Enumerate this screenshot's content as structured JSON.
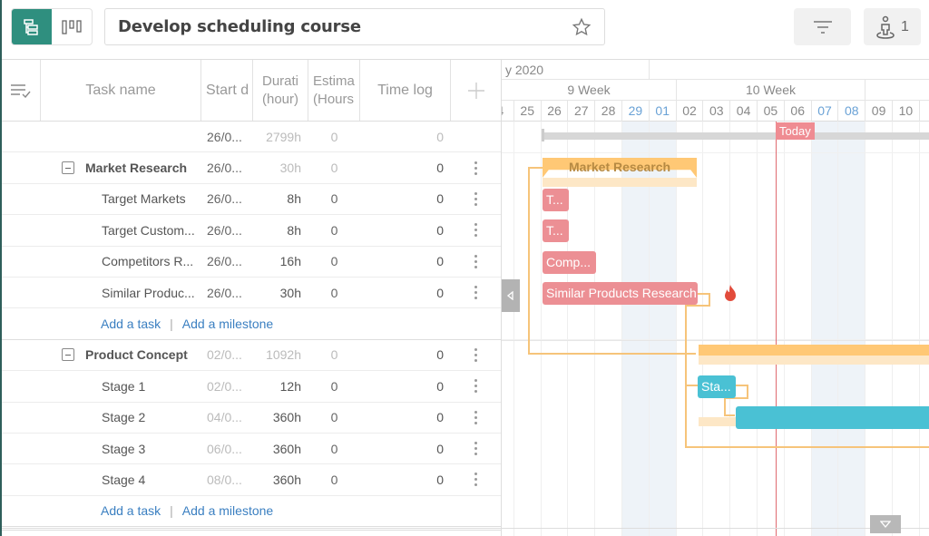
{
  "toolbar": {
    "title": "Develop scheduling course",
    "view_gantt_icon": "gantt-view-icon",
    "view_board_icon": "board-view-icon",
    "star_icon": "star-icon",
    "filter_icon": "filter-icon",
    "users_icon": "user-location-icon",
    "users_count": "1",
    "accent_color": "#2f8f7f"
  },
  "grid": {
    "columns": [
      {
        "key": "menu",
        "icon": "list-check-icon"
      },
      {
        "key": "name",
        "label": "Task name"
      },
      {
        "key": "start",
        "label": "Start d"
      },
      {
        "key": "duration",
        "label_line1": "Durati",
        "label_line2": "(hour)"
      },
      {
        "key": "estimate",
        "label_line1": "Estima",
        "label_line2": "(Hours"
      },
      {
        "key": "timelog",
        "label": "Time log"
      },
      {
        "key": "add",
        "icon": "plus-icon"
      }
    ],
    "project_row": {
      "start": "26/0...",
      "duration": "2799h",
      "estimate": "0",
      "timelog": "0"
    },
    "groups": [
      {
        "name": "Market Research",
        "start": "26/0...",
        "duration": "30h",
        "estimate": "0",
        "timelog": "0",
        "tasks": [
          {
            "name": "Target Markets",
            "start": "26/0...",
            "duration": "8h",
            "estimate": "0",
            "timelog": "0"
          },
          {
            "name": "Target Custom...",
            "start": "26/0...",
            "duration": "8h",
            "estimate": "0",
            "timelog": "0"
          },
          {
            "name": "Competitors R...",
            "start": "26/0...",
            "duration": "16h",
            "estimate": "0",
            "timelog": "0"
          },
          {
            "name": "Similar Produc...",
            "start": "26/0...",
            "duration": "30h",
            "estimate": "0",
            "timelog": "0"
          }
        ]
      },
      {
        "name": "Product Concept",
        "start": "02/0...",
        "duration": "1092h",
        "estimate": "0",
        "timelog": "0",
        "tasks": [
          {
            "name": "Stage 1",
            "start": "02/0...",
            "duration": "12h",
            "estimate": "0",
            "timelog": "0"
          },
          {
            "name": "Stage 2",
            "start": "04/0...",
            "duration": "360h",
            "estimate": "0",
            "timelog": "0"
          },
          {
            "name": "Stage 3",
            "start": "06/0...",
            "duration": "360h",
            "estimate": "0",
            "timelog": "0"
          },
          {
            "name": "Stage 4",
            "start": "08/0...",
            "duration": "360h",
            "estimate": "0",
            "timelog": "0"
          }
        ]
      }
    ],
    "add_task_label": "Add a task",
    "add_milestone_label": "Add a milestone",
    "separator": "|"
  },
  "timeline": {
    "month_label": "y 2020",
    "weeks": [
      {
        "label": "9 Week"
      },
      {
        "label": "10 Week"
      }
    ],
    "days": [
      {
        "label": "4",
        "weekend": false
      },
      {
        "label": "25",
        "weekend": false
      },
      {
        "label": "26",
        "weekend": false
      },
      {
        "label": "27",
        "weekend": false
      },
      {
        "label": "28",
        "weekend": false
      },
      {
        "label": "29",
        "weekend": true
      },
      {
        "label": "01",
        "weekend": true
      },
      {
        "label": "02",
        "weekend": false
      },
      {
        "label": "03",
        "weekend": false
      },
      {
        "label": "04",
        "weekend": false
      },
      {
        "label": "05",
        "weekend": false
      },
      {
        "label": "06",
        "weekend": false
      },
      {
        "label": "07",
        "weekend": true
      },
      {
        "label": "08",
        "weekend": true
      },
      {
        "label": "09",
        "weekend": false
      },
      {
        "label": "10",
        "weekend": false
      },
      {
        "label": "1",
        "weekend": false
      }
    ],
    "today_label": "Today",
    "bars": {
      "market_research": "Market Research",
      "target_markets": "T...",
      "target_customers": "T...",
      "competitors": "Comp...",
      "similar_products": "Similar Products Research",
      "stage1": "Sta...",
      "stage2": ""
    },
    "critical_icon": "fire-icon",
    "collapse_icon": "chevron-left-icon",
    "scroll_icon": "chevron-down-icon",
    "colors": {
      "task": "#ec8f94",
      "summary": "#ffc875",
      "stage": "#4ac1d4",
      "today": "#e06a70",
      "weekend": "#eef3f8"
    }
  }
}
